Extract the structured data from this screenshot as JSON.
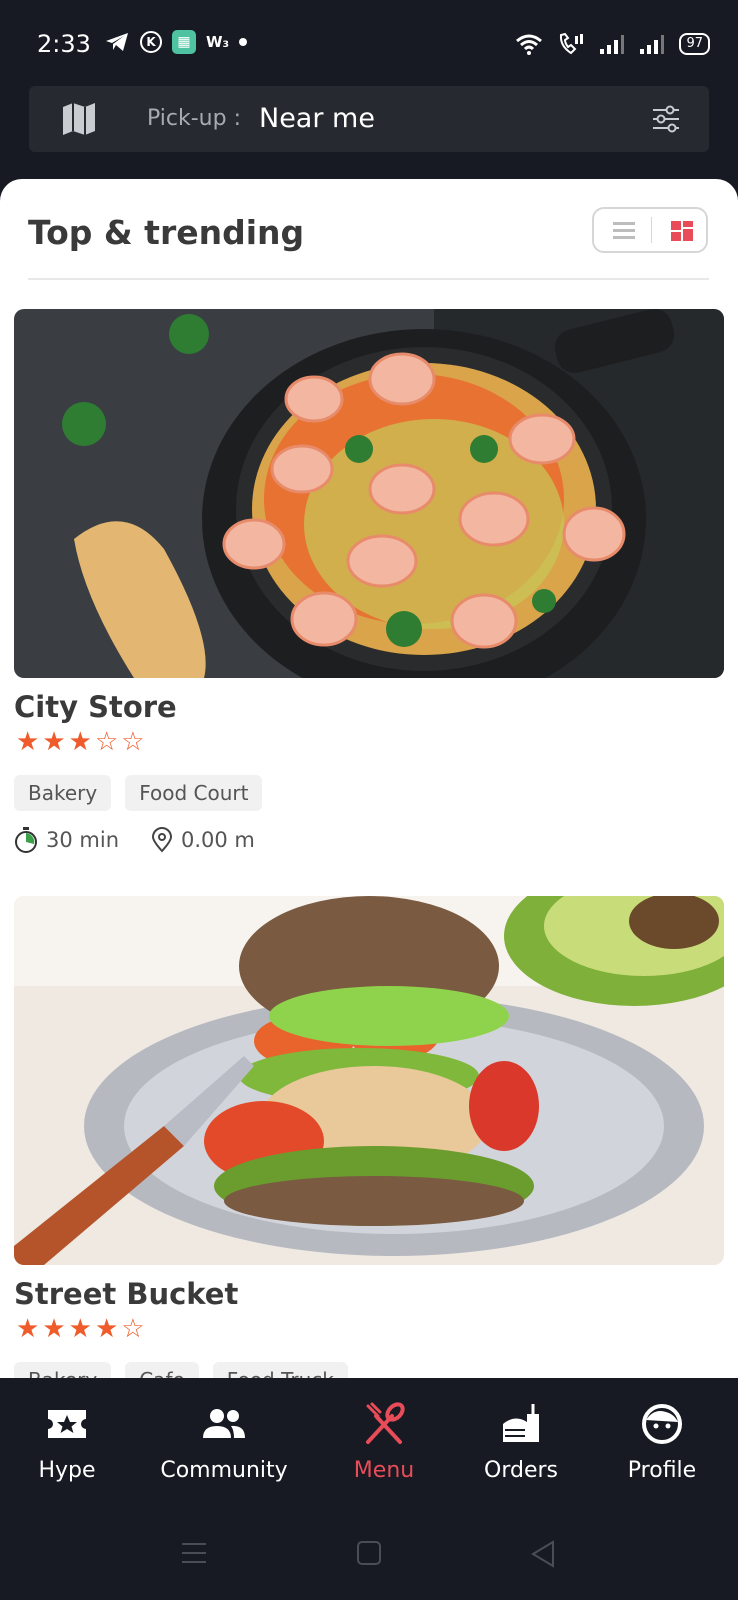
{
  "status_bar": {
    "time": "2:33",
    "left_icons": [
      "telegram-icon",
      "k-app-icon",
      "calculator-app-icon",
      "w-app-icon",
      "notification-dot-icon"
    ],
    "k_glyph": "K",
    "w_glyph": "W₃",
    "right_icons": [
      "wifi-icon",
      "volte-call-icon",
      "signal-1-icon",
      "signal-2-icon"
    ],
    "battery": "97"
  },
  "pickup": {
    "label": "Pick-up :",
    "value": "Near me"
  },
  "section": {
    "title": "Top & trending",
    "view_mode": "grid"
  },
  "stores": [
    {
      "name": "City Store",
      "rating": 3,
      "max_rating": 5,
      "tags": [
        "Bakery",
        "Food Court"
      ],
      "time": "30 min",
      "distance": "0.00 m",
      "image": "shrimp-zoodles-pan"
    },
    {
      "name": "Street Bucket",
      "rating": 4,
      "max_rating": 5,
      "tags": [
        "Bakery",
        "Cafe",
        "Food Truck"
      ],
      "image": "mushroom-burger-plate"
    }
  ],
  "bottom_nav": [
    {
      "label": "Hype",
      "icon": "ticket-star-icon",
      "active": false
    },
    {
      "label": "Community",
      "icon": "people-icon",
      "active": false
    },
    {
      "label": "Menu",
      "icon": "fork-knife-icon",
      "active": true
    },
    {
      "label": "Orders",
      "icon": "takeaway-bag-icon",
      "active": false
    },
    {
      "label": "Profile",
      "icon": "face-icon",
      "active": false
    }
  ],
  "colors": {
    "background": "#171a22",
    "accent": "#e84c58",
    "star": "#ef5b2b",
    "surface": "#ffffff",
    "pickup_bar": "#262930"
  }
}
